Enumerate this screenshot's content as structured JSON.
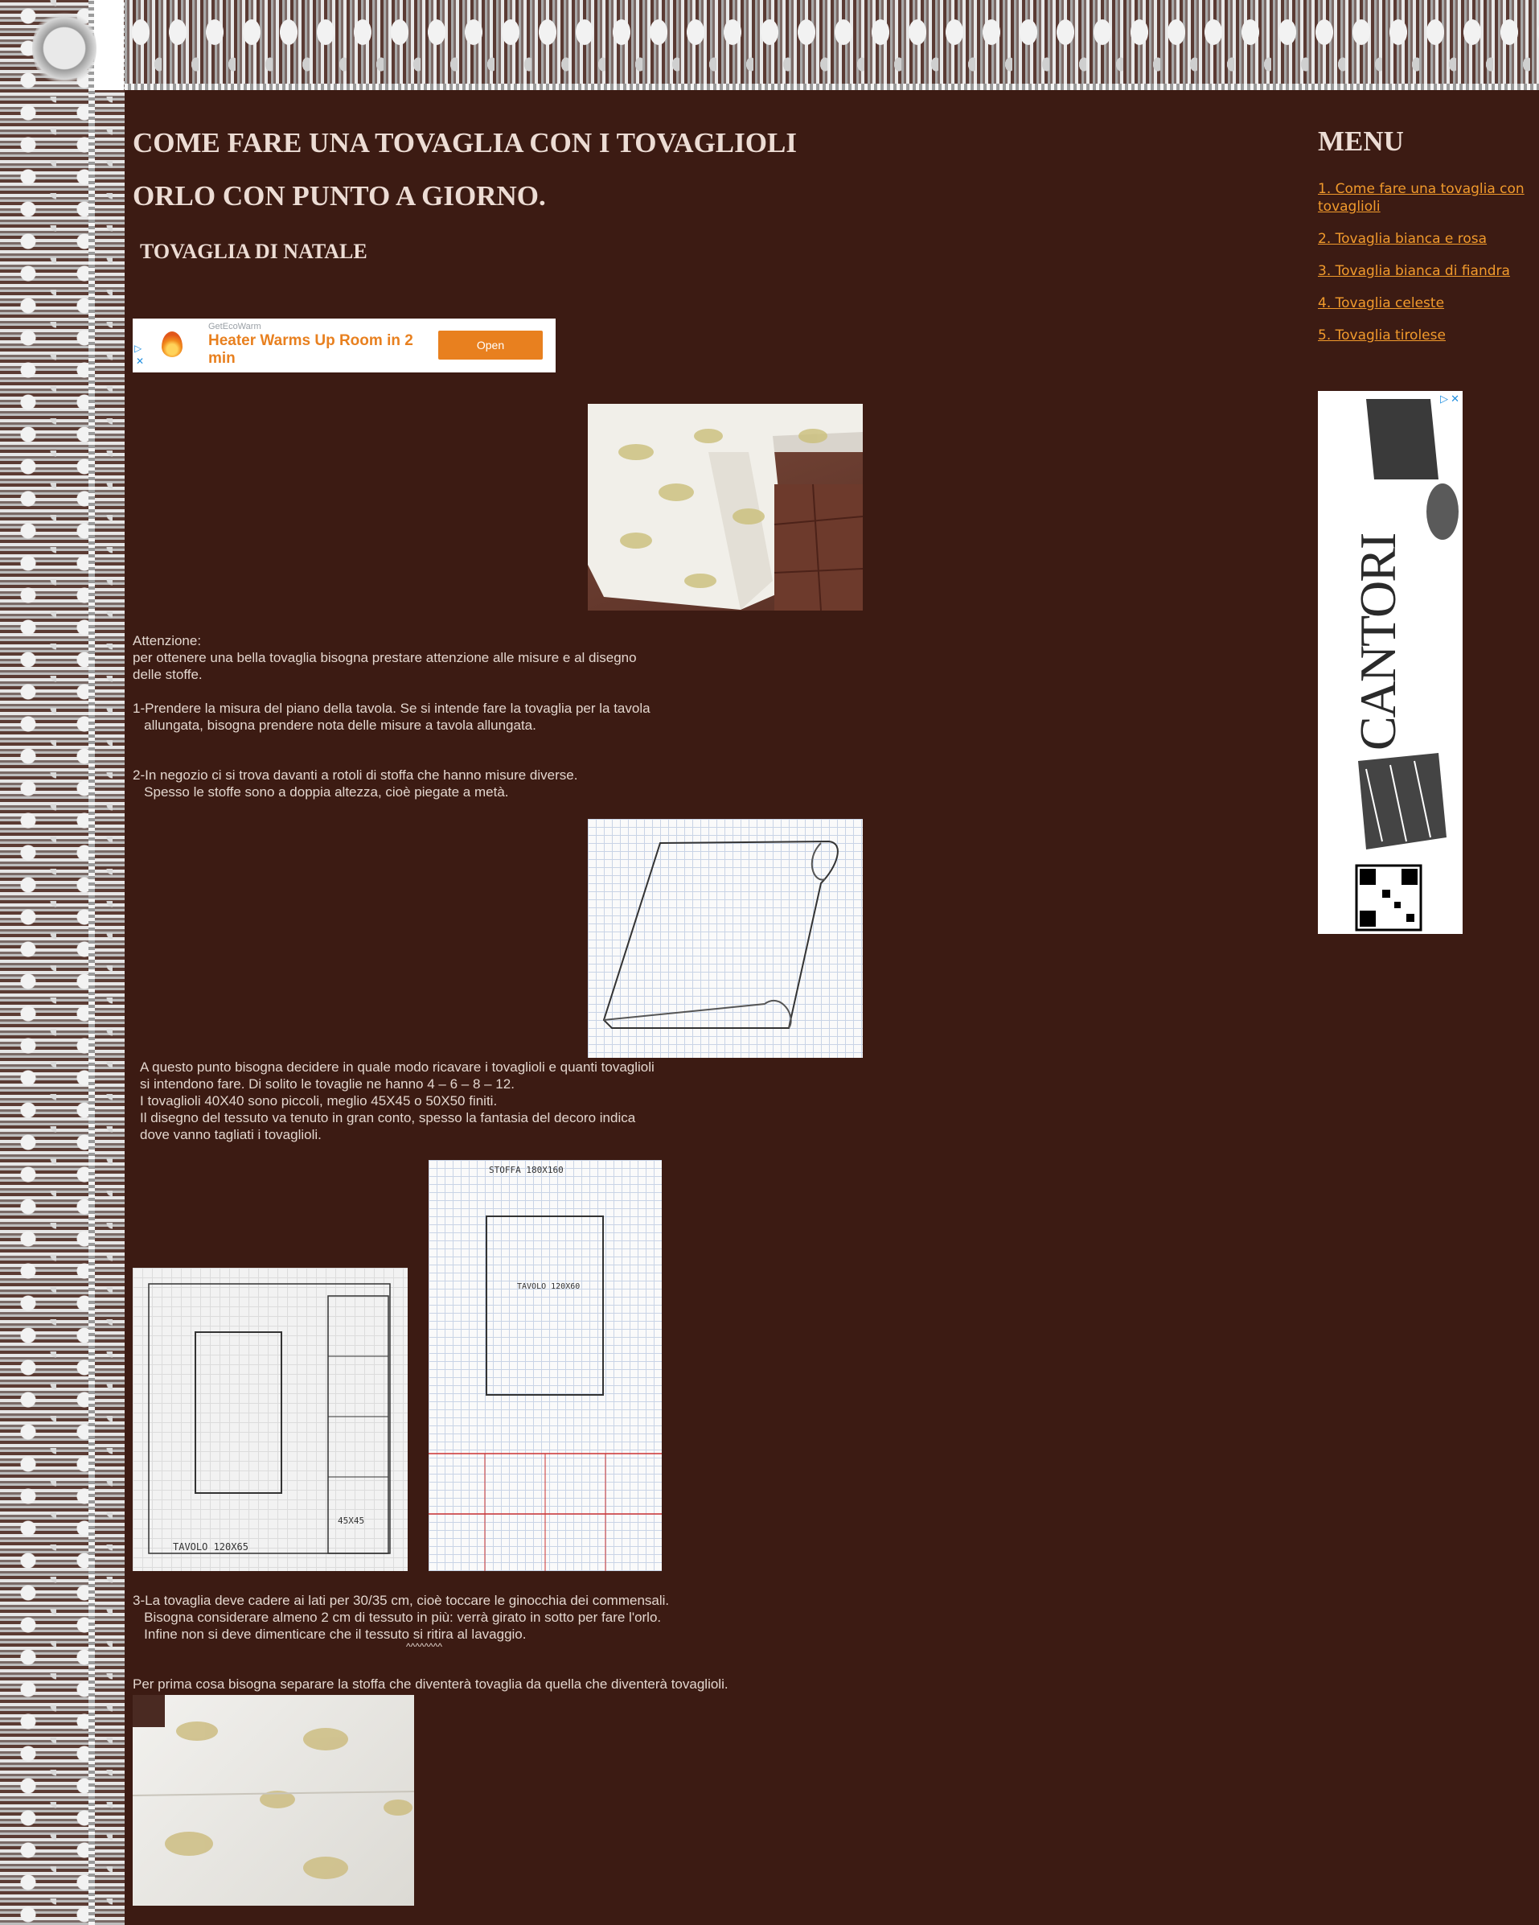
{
  "header": {
    "title_line1": "COME FARE UNA TOVAGLIA CON I TOVAGLIOLI",
    "title_line2": "ORLO CON PUNTO A GIORNO.",
    "subtitle": "TOVAGLIA DI NATALE"
  },
  "ad_banner": {
    "brand": "GetEcoWarm",
    "headline": "Heater Warms Up Room in 2 min",
    "button": "Open"
  },
  "body": {
    "attention": "Attenzione:\nper ottenere una bella tovaglia bisogna prestare attenzione alle misure e al disegno\ndelle stoffe.\n\n1-Prendere la misura del piano della tavola. Se si intende fare la tovaglia per la tavola\n   allungata, bisogna prendere nota delle misure a tavola allungata.",
    "step2": "2-In negozio ci si trova davanti a rotoli di stoffa che hanno misure diverse.\n   Spesso le stoffe sono a doppia altezza, cioè piegate a metà.",
    "step2b": "A questo punto bisogna decidere in quale modo ricavare i tovaglioli e quanti tovaglioli\nsi intendono fare. Di solito le tovaglie ne hanno 4 – 6 – 8 – 12.\nI tovaglioli 40X40 sono piccoli, meglio 45X45 o 50X50 finiti.\nIl disegno del tessuto va tenuto in gran conto, spesso la fantasia del decoro indica\ndove vanno tagliati i tovaglioli.",
    "step3": "3-La tovaglia deve cadere ai lati per 30/35 cm, cioè toccare le ginocchia dei commensali.\n   Bisogna considerare almeno 2 cm di tessuto in più: verrà girato in sotto per fare l'orlo.\n   Infine non si deve dimenticare che il tessuto si ritira al lavaggio.",
    "carets": "^^^^^^^^",
    "separate": "Per prima cosa bisogna separare la stoffa che diventerà tovaglia da quella che diventerà tovaglioli."
  },
  "sketch_labels": {
    "tavolo_left": "TAVOLO 120X65",
    "napkin": "45X45",
    "stoffa": "STOFFA 180X160",
    "tavolo_right": "TAVOLO 120X60"
  },
  "sidebar": {
    "title": "MENU",
    "items": [
      {
        "label": "1. Come fare una tovaglia con tovaglioli"
      },
      {
        "label": "2. Tovaglia bianca e rosa"
      },
      {
        "label": "3. Tovaglia bianca di fiandra"
      },
      {
        "label": "4. Tovaglia celeste"
      },
      {
        "label": "5. Tovaglia tirolese"
      }
    ],
    "ad_brand": "CANTORI"
  },
  "colors": {
    "background": "#3c1b13",
    "link": "#f19a2c",
    "ad_accent": "#e8801f"
  }
}
